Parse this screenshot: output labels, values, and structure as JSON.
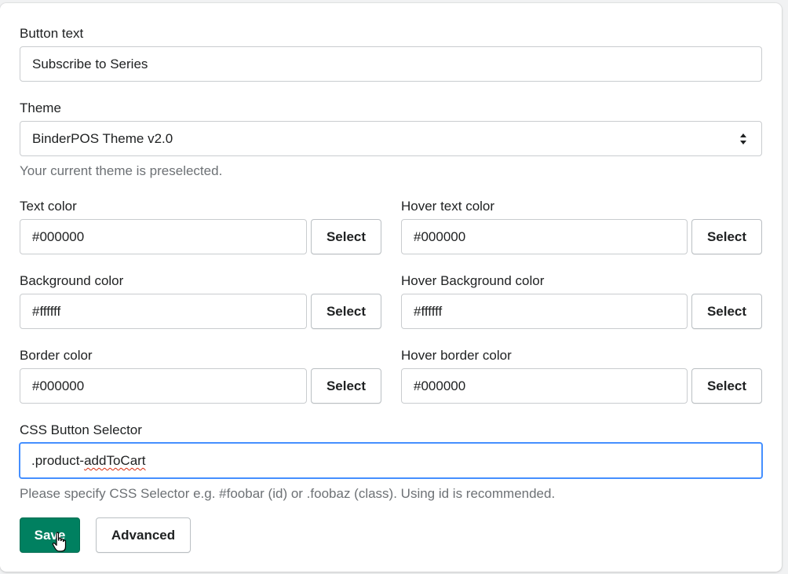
{
  "form": {
    "button_text": {
      "label": "Button text",
      "value": "Subscribe to Series"
    },
    "theme": {
      "label": "Theme",
      "value": "BinderPOS Theme v2.0",
      "help": "Your current theme is preselected."
    },
    "colors": {
      "text_color": {
        "label": "Text color",
        "value": "#000000",
        "button": "Select"
      },
      "hover_text_color": {
        "label": "Hover text color",
        "value": "#000000",
        "button": "Select"
      },
      "background_color": {
        "label": "Background color",
        "value": "#ffffff",
        "button": "Select"
      },
      "hover_background_color": {
        "label": "Hover Background color",
        "value": "#ffffff",
        "button": "Select"
      },
      "border_color": {
        "label": "Border color",
        "value": "#000000",
        "button": "Select"
      },
      "hover_border_color": {
        "label": "Hover border color",
        "value": "#000000",
        "button": "Select"
      }
    },
    "css_selector": {
      "label": "CSS Button Selector",
      "value_prefix": ".product-",
      "value_misspelled": "addToCart",
      "help": "Please specify CSS Selector e.g. #foobar (id) or .foobaz (class). Using id is recommended."
    }
  },
  "actions": {
    "save_label": "Save",
    "advanced_label": "Advanced"
  },
  "style": {
    "primary": "#008060",
    "focus_ring": "#458fff",
    "help_text": "#6d7175"
  },
  "icons": {
    "select_arrows": "up-down-chevron-icon",
    "cursor": "hand-pointer-icon"
  }
}
